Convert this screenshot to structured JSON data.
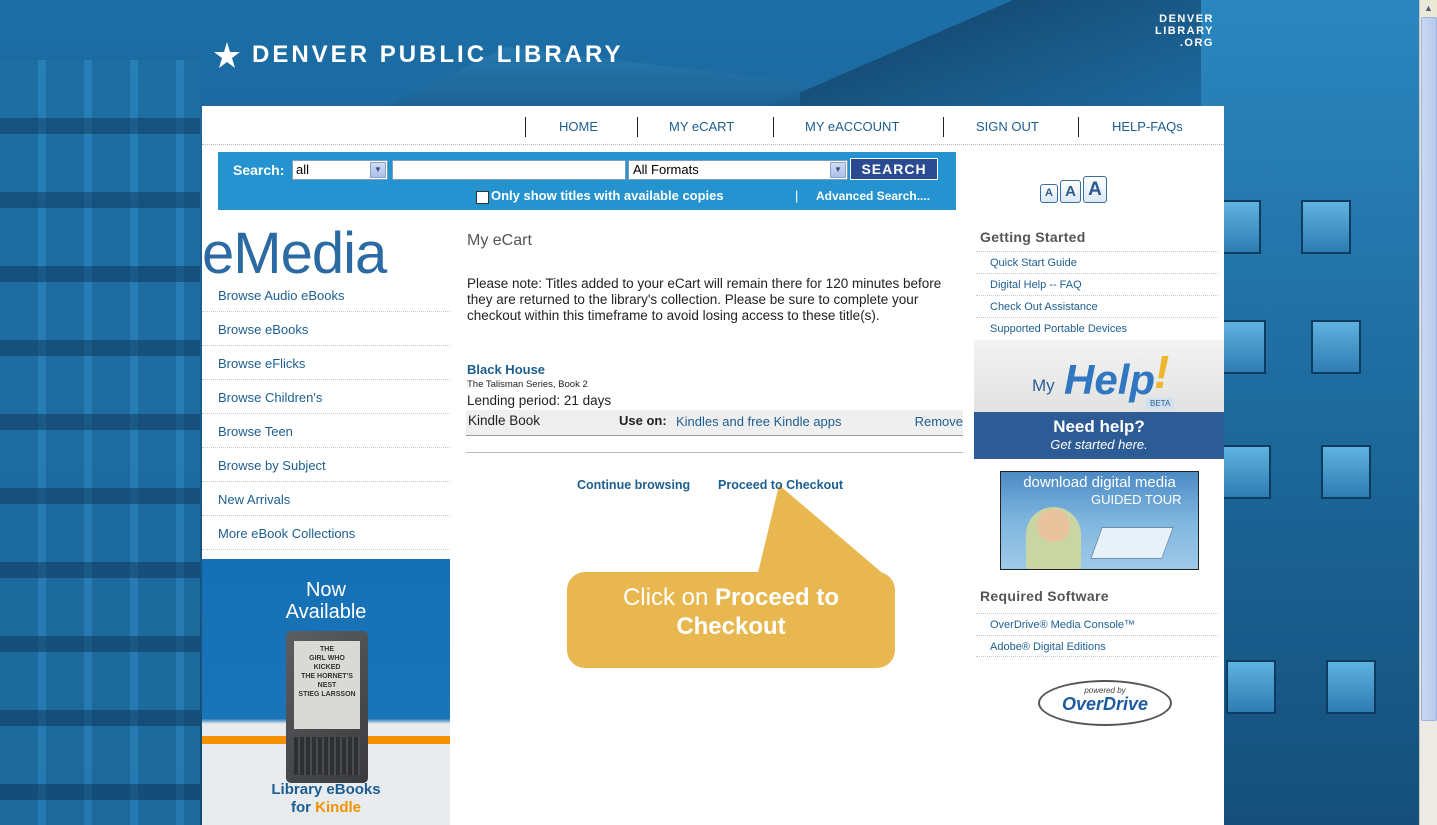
{
  "header": {
    "site_name": "DENVER PUBLIC LIBRARY",
    "corner_logo": [
      "DENVER",
      "LIBRARY",
      ".ORG"
    ]
  },
  "topnav": {
    "items": [
      "HOME",
      "MY eCART",
      "MY eACCOUNT",
      "SIGN OUT",
      "HELP-FAQs"
    ]
  },
  "search": {
    "label": "Search:",
    "scope_value": "all",
    "query_value": "",
    "format_value": "All Formats",
    "button_label": "SEARCH",
    "available_only_label": "Only show titles with available copies",
    "separator": "|",
    "advanced_label": "Advanced Search...."
  },
  "font_size_buttons": [
    "A",
    "A",
    "A"
  ],
  "left": {
    "title": "eMedia",
    "nav_items": [
      "Browse Audio eBooks",
      "Browse eBooks",
      "Browse eFlicks",
      "Browse Children's",
      "Browse Teen",
      "Browse by Subject",
      "New Arrivals",
      "More eBook Collections"
    ],
    "promo": {
      "line1": "Now",
      "line2": "Available",
      "bottom_line1": "Library eBooks",
      "bottom_for": "for",
      "bottom_kindle": "Kindle",
      "book_cover_text": [
        "THE",
        "GIRL WHO",
        "KICKED",
        "THE HORNET'S",
        "NEST",
        "STIEG LARSSON"
      ]
    }
  },
  "cart": {
    "title": "My eCart",
    "note": "Please note: Titles added to your eCart will remain there for 120 minutes before they are returned to the library's collection. Please be sure to complete your checkout within this timeframe to avoid losing access to these title(s).",
    "item": {
      "title": "Black House",
      "series": "The Talisman Series, Book 2",
      "lending": "Lending period: 21 days",
      "format": "Kindle Book",
      "use_on_label": "Use on:",
      "use_on_value": "Kindles and free Kindle apps",
      "remove_label": "Remove"
    },
    "continue_label": "Continue browsing",
    "checkout_label": "Proceed to Checkout"
  },
  "callout": {
    "text_prefix": "Click on",
    "text_bold": "Proceed to Checkout"
  },
  "right": {
    "getting_started_title": "Getting Started",
    "getting_started_items": [
      "Quick Start Guide",
      "Digital Help -- FAQ",
      "Check Out Assistance",
      "Supported Portable Devices"
    ],
    "myhelp": {
      "my": "My",
      "help": "Help",
      "bang": "!",
      "beta": "BETA",
      "need_help": "Need help?",
      "get_started": "Get started here."
    },
    "guided_tour": {
      "line1": "download digital media",
      "line2": "GUIDED TOUR"
    },
    "required_software_title": "Required Software",
    "software_items": [
      "OverDrive® Media Console™",
      "Adobe® Digital Editions"
    ],
    "powered_by": "powered by",
    "overdrive": "OverDrive"
  },
  "colors": {
    "panel_bg": "#ffffff",
    "search_bar": "#2493cf",
    "link": "#1d5e91",
    "callout": "#e9b74f",
    "kindle_orange": "#f39100"
  }
}
